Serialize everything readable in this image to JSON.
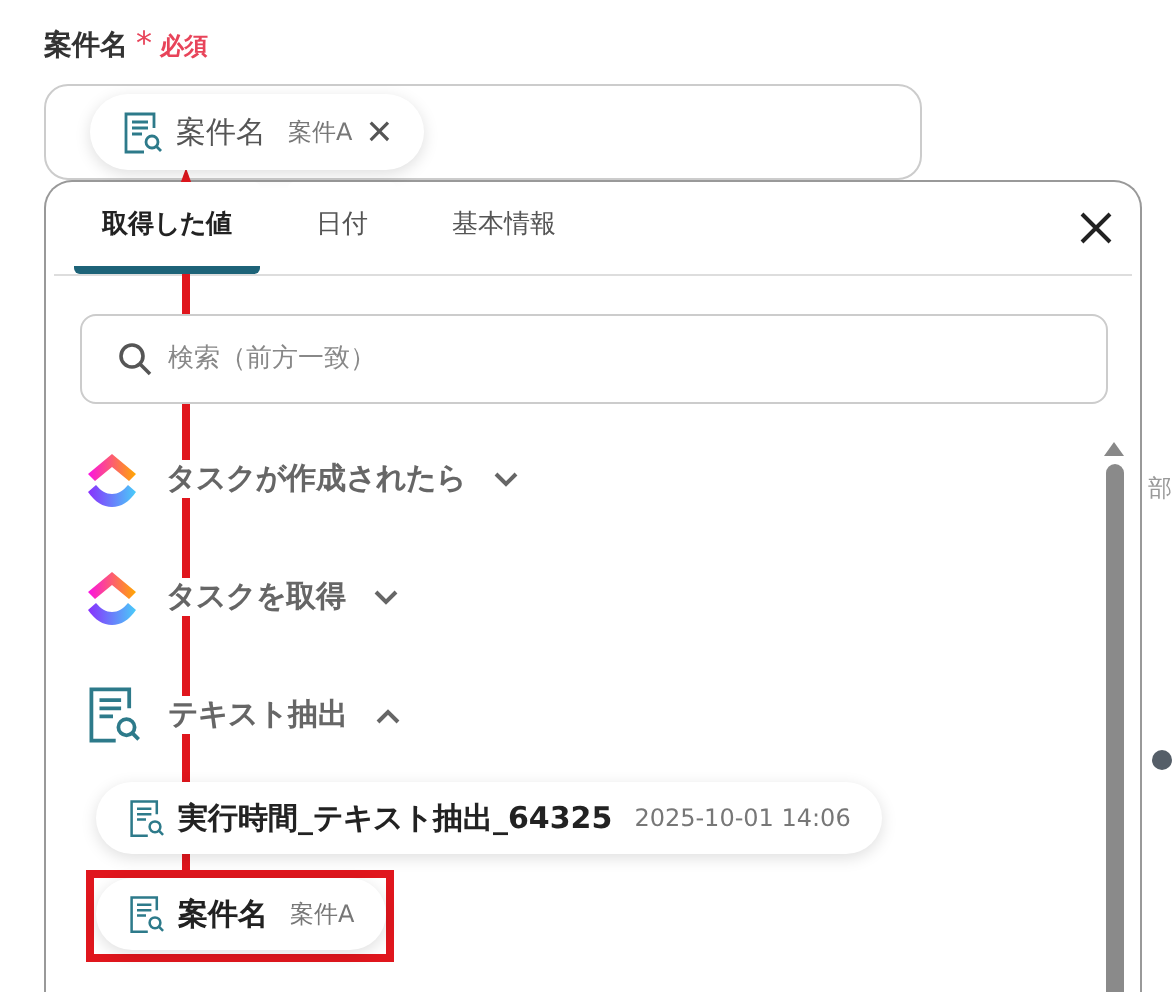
{
  "field": {
    "label": "案件名",
    "required_mark": "*",
    "required_text": "必須",
    "chip": {
      "name": "案件名",
      "value": "案件A",
      "remove": "×"
    }
  },
  "picker": {
    "tabs": [
      {
        "label": "取得した値",
        "selected": true
      },
      {
        "label": "日付",
        "selected": false
      },
      {
        "label": "基本情報",
        "selected": false
      }
    ],
    "search": {
      "placeholder": "検索（前方一致）"
    },
    "groups": [
      {
        "kind": "app",
        "title": "タスクが作成されたら",
        "expanded": false
      },
      {
        "kind": "app",
        "title": "タスクを取得",
        "expanded": false
      },
      {
        "kind": "doc",
        "title": "テキスト抽出",
        "expanded": true,
        "items": [
          {
            "name": "実行時間_テキスト抽出_64325",
            "value": "2025-10-01 14:06",
            "highlighted": false
          },
          {
            "name": "案件名",
            "value": "案件A",
            "highlighted": true
          }
        ]
      }
    ]
  },
  "side_text": "部"
}
